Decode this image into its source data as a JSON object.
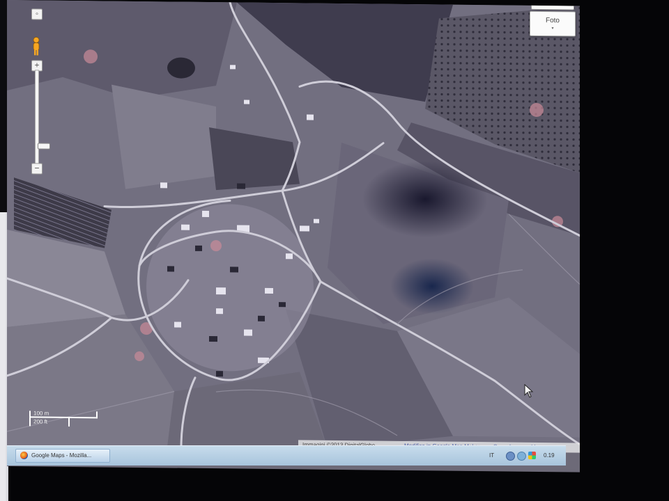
{
  "map_type_button": {
    "label": "Foto",
    "arrow": "▾"
  },
  "zoom_control": {
    "zoom_in": "+",
    "zoom_out": "−",
    "pegman_icon": "pegman-icon",
    "pan_icon": "pan-icon"
  },
  "scale": {
    "metric": "100 m",
    "imperial": "200 ft"
  },
  "attribution": {
    "credit": "Immagini ©2013 DigitalGlobe -",
    "link_map_maker": "Modifica in Google Map Maker",
    "link_report": "Segnala un problema"
  },
  "taskbar": {
    "item_label": "Google Maps - Mozilla...",
    "item_icon": "firefox-icon",
    "tray_language": "IT",
    "tray_time": "0.19"
  },
  "colors": {
    "attribution_link": "#4a5fa8",
    "taskbar": "#b3cce2"
  }
}
